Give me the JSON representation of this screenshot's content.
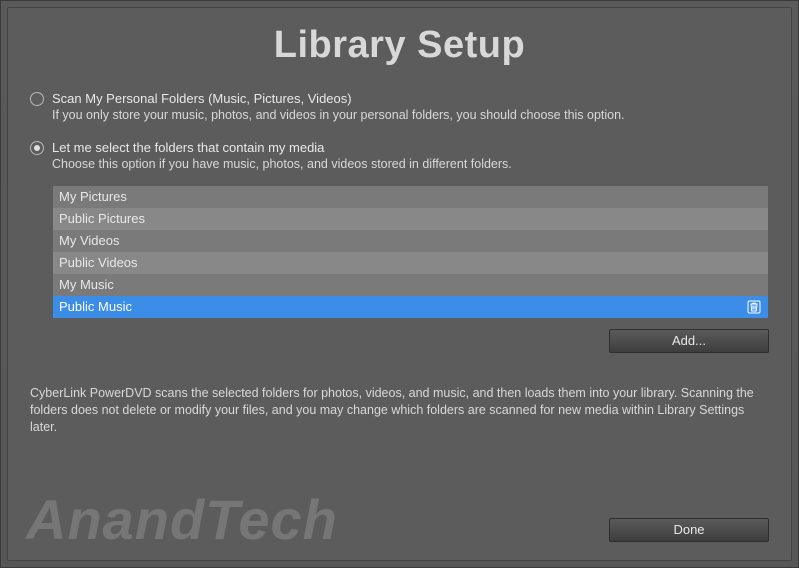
{
  "title": "Library Setup",
  "options": [
    {
      "label": "Scan My Personal Folders (Music, Pictures, Videos)",
      "desc": "If you only store your music, photos, and videos in your personal folders, you should choose this option.",
      "selected": false
    },
    {
      "label": "Let me select the folders that contain my media",
      "desc": "Choose this option if you have music, photos, and videos stored in different folders.",
      "selected": true
    }
  ],
  "folders": [
    {
      "name": "My Pictures",
      "selected": false
    },
    {
      "name": "Public Pictures",
      "selected": false
    },
    {
      "name": "My Videos",
      "selected": false
    },
    {
      "name": "Public Videos",
      "selected": false
    },
    {
      "name": "My Music",
      "selected": false
    },
    {
      "name": "Public Music",
      "selected": true
    }
  ],
  "buttons": {
    "add": "Add...",
    "done": "Done"
  },
  "info": "CyberLink PowerDVD scans the selected folders for photos, videos, and music, and then loads them into your library. Scanning the folders does not delete or modify your files, and you may change which folders are scanned for new media within Library Settings later.",
  "watermark": "AnandTech"
}
